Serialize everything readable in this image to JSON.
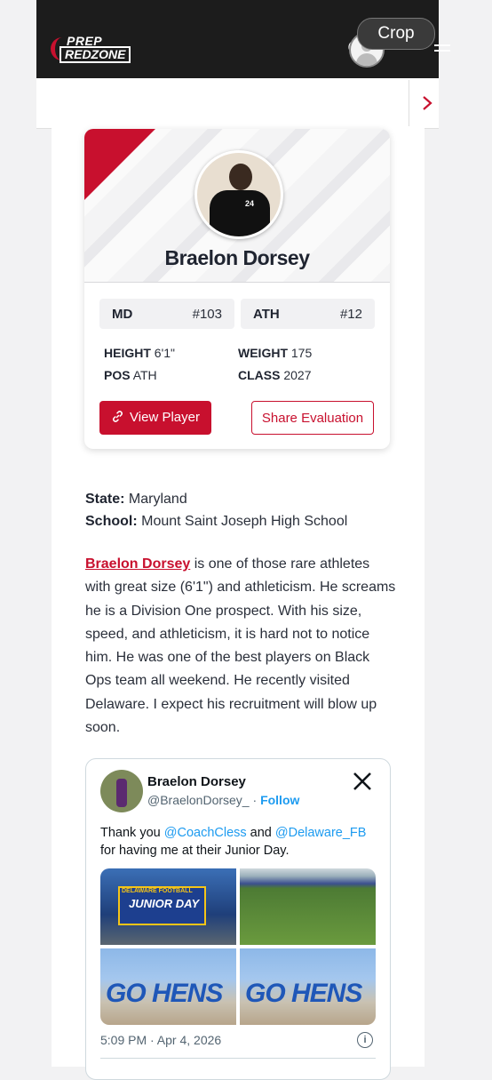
{
  "header": {
    "logo_top": "PREP",
    "logo_bottom": "REDZONE",
    "crop_label": "Crop"
  },
  "icons": {
    "search": "search-icon",
    "avatar": "user-avatar-icon",
    "menu": "hamburger-menu-icon",
    "chevron": "chevron-right-icon"
  },
  "colors": {
    "brand_red": "#c8102e",
    "header_bg": "#1c1c1c",
    "twitter_blue": "#1d9bf0"
  },
  "player": {
    "name": "Braelon Dorsey",
    "jersey_number": "24",
    "state_rank_label": "MD",
    "state_rank": "#103",
    "position_rank_label": "ATH",
    "position_rank": "#12",
    "height_label": "HEIGHT",
    "height": "6'1\"",
    "weight_label": "WEIGHT",
    "weight": "175",
    "pos_label": "POS",
    "pos": "ATH",
    "class_label": "CLASS",
    "class": "2027",
    "view_button": "View Player",
    "share_button": "Share Evaluation"
  },
  "details": {
    "state_label": "State:",
    "state": "Maryland",
    "school_label": "School:",
    "school": "Mount Saint Joseph High School"
  },
  "article": {
    "link_text": "Braelon Dorsey",
    "body": " is one of those rare athletes with great size (6'1\") and athleticism. He screams he is a Division One prospect. With his size, speed, and athleticism, it is hard not to notice him. He was one of the best players on Black Ops team all weekend. He recently visited Delaware. I expect his recruitment will blow up soon."
  },
  "tweet": {
    "name": "Braelon Dorsey",
    "handle": "@BraelonDorsey_",
    "separator": "·",
    "follow": "Follow",
    "text_1": "Thank you ",
    "mention_1": "@CoachCless",
    "text_2": " and ",
    "mention_2": "@Delaware_FB",
    "text_3": " for having me at their Junior Day.",
    "image_1_top": "DELAWARE FOOTBALL",
    "image_1_main": "JUNIOR DAY",
    "image_3_text": "GO HENS",
    "image_4_text": "GO HENS",
    "timestamp": "5:09 PM · Apr 4, 2026",
    "info": "i"
  }
}
